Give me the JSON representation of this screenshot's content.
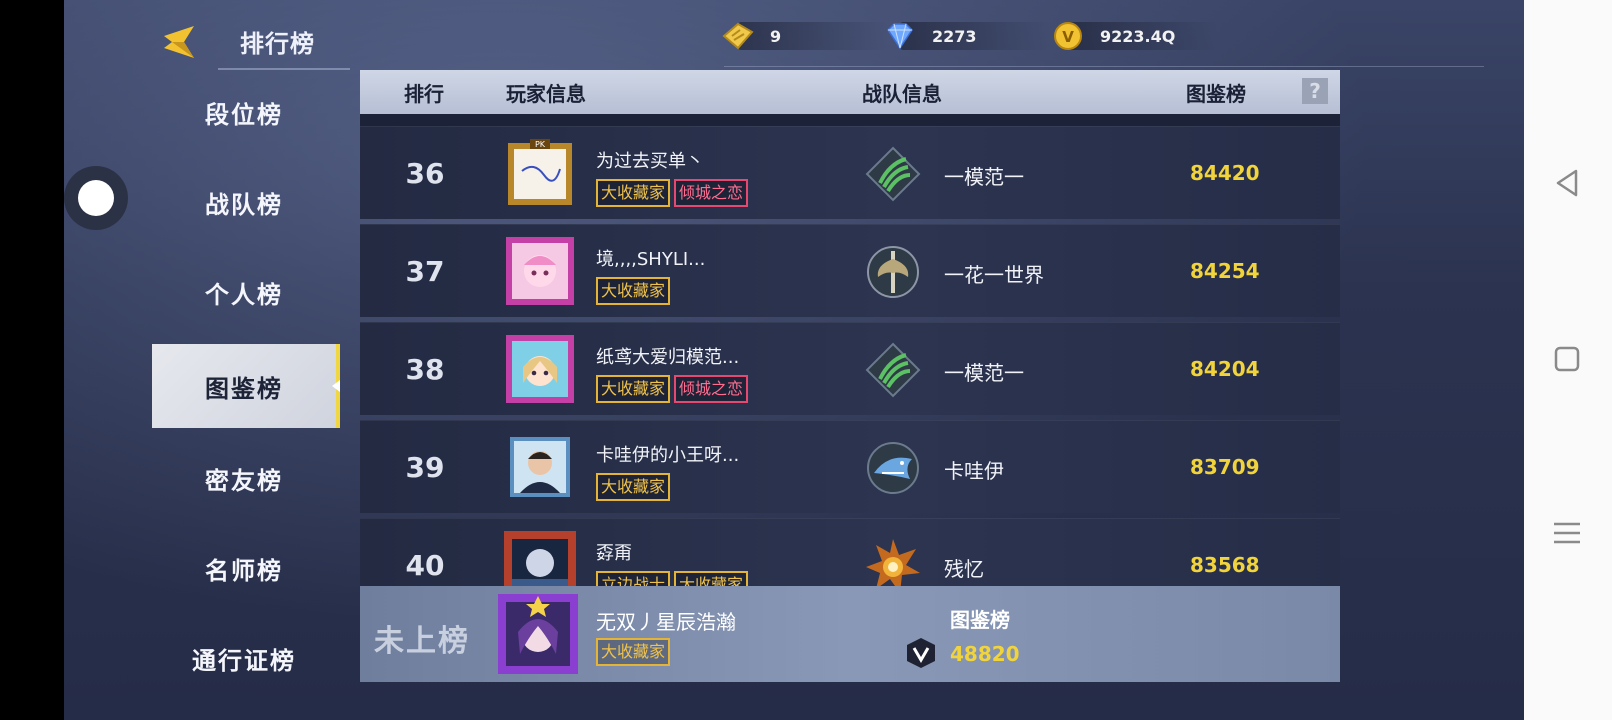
{
  "topbar": {
    "title": "排行榜",
    "currencies": [
      {
        "icon": "gold-ticket-icon",
        "value": "9"
      },
      {
        "icon": "diamond-icon",
        "value": "2273"
      },
      {
        "icon": "coin-icon",
        "value": "9223.4Q"
      }
    ]
  },
  "sidebar": {
    "items": [
      {
        "label": "段位榜"
      },
      {
        "label": "战队榜"
      },
      {
        "label": "个人榜"
      },
      {
        "label": "图鉴榜"
      },
      {
        "label": "密友榜"
      },
      {
        "label": "名师榜"
      },
      {
        "label": "通行证榜"
      }
    ],
    "active_index": 3
  },
  "table": {
    "headers": {
      "rank": "排行",
      "player": "玩家信息",
      "team": "战队信息",
      "score": "图鉴榜",
      "help": "?"
    },
    "rows": [
      {
        "rank": "36",
        "name": "为过去买单丶",
        "badges": [
          "大收藏家",
          "倾城之恋"
        ],
        "team": "一模范一",
        "team_icon": "green-claw-icon",
        "score": "84420"
      },
      {
        "rank": "37",
        "name": "境,,,,SHYLI...",
        "badges": [
          "大收藏家"
        ],
        "team": "一花一世界",
        "team_icon": "silver-axe-icon",
        "score": "84254"
      },
      {
        "rank": "38",
        "name": "纸鸢大爱归模范...",
        "badges": [
          "大收藏家",
          "倾城之恋"
        ],
        "team": "一模范一",
        "team_icon": "green-claw-icon",
        "score": "84204"
      },
      {
        "rank": "39",
        "name": "卡哇伊的小王呀...",
        "badges": [
          "大收藏家"
        ],
        "team": "卡哇伊",
        "team_icon": "shark-icon",
        "score": "83709"
      },
      {
        "rank": "40",
        "name": "孬甭",
        "badges": [
          "立边战士",
          "大收藏家"
        ],
        "team": "残忆",
        "team_icon": "sun-emblem-icon",
        "score": "83568"
      }
    ]
  },
  "mine": {
    "status": "未上榜",
    "name": "无双丿星辰浩瀚",
    "badges": [
      "大收藏家"
    ],
    "score_label": "图鉴榜",
    "score": "48820"
  },
  "colors": {
    "accent": "#f1d43c",
    "badge_gold": "#e3b435",
    "badge_pink": "#e6496f"
  }
}
